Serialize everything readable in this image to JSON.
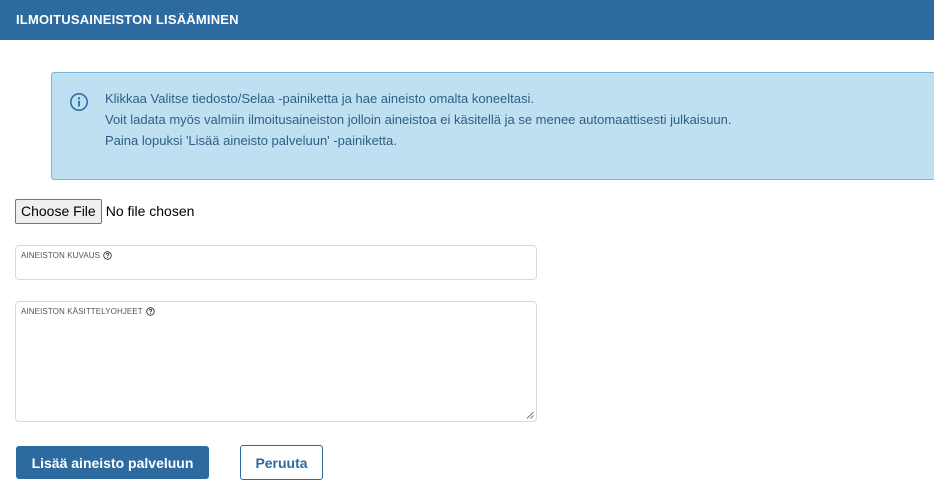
{
  "header": {
    "title": "ILMOITUSAINEISTON LISÄÄMINEN"
  },
  "info": {
    "icon": "info-circle-icon",
    "lines": [
      "Klikkaa Valitse tiedosto/Selaa -painiketta ja hae aineisto omalta koneeltasi.",
      "Voit ladata myös valmiin ilmoitusaineiston jolloin aineistoa ei käsitellä ja se menee automaattisesti julkaisuun.",
      "Paina lopuksi 'Lisää aineisto palveluun' -painiketta."
    ]
  },
  "file_input": {
    "button_label": "Choose File",
    "status": "No file chosen"
  },
  "fields": {
    "description": {
      "label": "AINEISTON KUVAUS",
      "value": ""
    },
    "instructions": {
      "label": "AINEISTON KÄSITTELYOHJEET",
      "value": ""
    }
  },
  "actions": {
    "submit_label": "Lisää aineisto palveluun",
    "cancel_label": "Peruuta"
  },
  "colors": {
    "header": "#2d6a9f",
    "info_bg": "#bee0f1",
    "info_text": "#2f5e85"
  }
}
